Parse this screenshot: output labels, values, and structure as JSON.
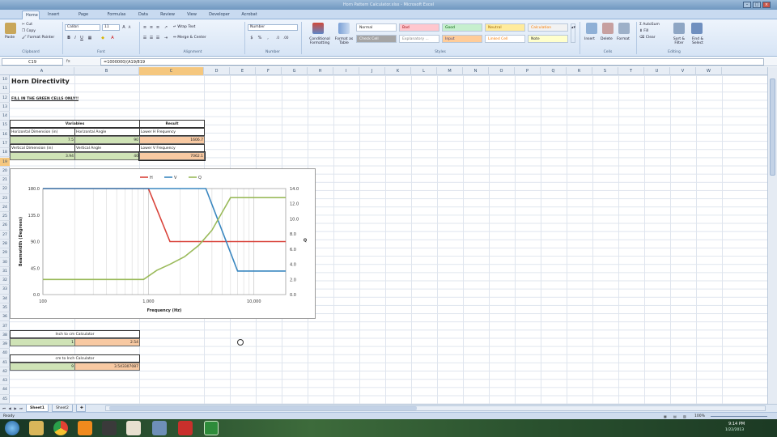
{
  "window": {
    "title": "Horn Pattern Calculator.xlsx - Microsoft Excel"
  },
  "ribbon_tabs": [
    "Home",
    "Insert",
    "Page Layout",
    "Formulas",
    "Data",
    "Review",
    "View",
    "Developer",
    "Acrobat"
  ],
  "ribbon": {
    "clipboard": {
      "paste": "Paste",
      "cut": "Cut",
      "copy": "Copy",
      "format_painter": "Format Painter",
      "label": "Clipboard"
    },
    "font": {
      "name": "Calibri",
      "size": "11",
      "label": "Font"
    },
    "alignment": {
      "wrap": "Wrap Text",
      "merge": "Merge & Center",
      "label": "Alignment"
    },
    "number": {
      "format": "Number",
      "label": "Number"
    },
    "styles": {
      "cond": "Conditional Formatting",
      "table": "Format as Table",
      "cell_styles": [
        {
          "name": "Normal",
          "bg": "#ffffff",
          "fg": "#222222"
        },
        {
          "name": "Bad",
          "bg": "#ffc7ce",
          "fg": "#9c0006"
        },
        {
          "name": "Good",
          "bg": "#c6efce",
          "fg": "#006100"
        },
        {
          "name": "Neutral",
          "bg": "#ffeb9c",
          "fg": "#9c6500"
        },
        {
          "name": "Calculation",
          "bg": "#f2f2f2",
          "fg": "#fa7d00"
        },
        {
          "name": "Check Cell",
          "bg": "#a5a5a5",
          "fg": "#ffffff"
        },
        {
          "name": "Explanatory ...",
          "bg": "#ffffff",
          "fg": "#7f7f7f"
        },
        {
          "name": "Input",
          "bg": "#ffcc99",
          "fg": "#3f3f76"
        },
        {
          "name": "Linked Cell",
          "bg": "#ffffff",
          "fg": "#fa7d00"
        },
        {
          "name": "Note",
          "bg": "#ffffcc",
          "fg": "#222222"
        }
      ],
      "label": "Styles"
    },
    "cells": {
      "insert": "Insert",
      "delete": "Delete",
      "format": "Format",
      "label": "Cells"
    },
    "editing": {
      "autosum": "AutoSum",
      "fill": "Fill",
      "clear": "Clear",
      "sort": "Sort & Filter",
      "find": "Find & Select",
      "label": "Editing"
    }
  },
  "formula_bar": {
    "name_box": "C19",
    "fx": "fx",
    "formula": "=1000000/(A19/819"
  },
  "columns": [
    "A",
    "B",
    "C",
    "D",
    "E",
    "F",
    "G",
    "H",
    "I",
    "J",
    "K",
    "L",
    "M",
    "N",
    "O",
    "P",
    "Q",
    "R",
    "S",
    "T",
    "U",
    "V",
    "W"
  ],
  "rows": [
    "10",
    "11",
    "12",
    "13",
    "14",
    "15",
    "16",
    "17",
    "18",
    "19",
    "20",
    "21",
    "22",
    "23",
    "24",
    "25",
    "26",
    "27",
    "28",
    "29",
    "30",
    "31",
    "32",
    "33",
    "34",
    "35",
    "36",
    "37",
    "38",
    "39",
    "40",
    "41",
    "42",
    "43",
    "44",
    "45"
  ],
  "sheet": {
    "title": "Horn Directivity",
    "instruction": "FILL IN THE GREEN CELLS ONLY!!",
    "variables_header": "Variables",
    "result_header": "Result",
    "h_dim_label": "Horizontal Dimension (in)",
    "h_angle_label": "Horizontal Angle",
    "lower_h_label": "Lower H Frequency",
    "h_dim": "7.5",
    "h_angle": "90",
    "lower_h": "1606.7",
    "v_dim_label": "Vertical Dimension (in)",
    "v_angle_label": "Vertical Angle",
    "lower_v_label": "Lower V Frequency",
    "v_dim": "3.94",
    "v_angle": "40",
    "lower_v": "7062.1",
    "inch_to_cm_label": "Inch to cm Calculator",
    "inch_value": "1",
    "cm_value": "2.54",
    "cm_to_inch_label": "cm to Inch Calculator",
    "cm_input": "9",
    "inch_result": "3.543307087"
  },
  "chart_data": {
    "type": "line",
    "x_scale": "log",
    "xlabel": "Frequency (Hz)",
    "ylabel": "Beamwidth (Degrees)",
    "y2label": "Q",
    "ylim": [
      0,
      180
    ],
    "y2lim": [
      0,
      14
    ],
    "xlim": [
      100,
      20000
    ],
    "y_ticks": [
      "0.0",
      "45.0",
      "90.0",
      "135.0",
      "180.0"
    ],
    "y2_ticks": [
      "0.0",
      "2.0",
      "4.0",
      "6.0",
      "8.0",
      "10.0",
      "12.0",
      "14.0"
    ],
    "x_ticks": [
      "100",
      "1,000",
      "10,000"
    ],
    "x_tick_values": [
      100,
      1000,
      10000
    ],
    "legend_position": "top",
    "series": [
      {
        "name": "H",
        "color": "#d9433a",
        "axis": "left",
        "x": [
          100,
          1000,
          1600,
          20000
        ],
        "y": [
          180,
          180,
          90,
          90
        ]
      },
      {
        "name": "V",
        "color": "#3a87c0",
        "axis": "left",
        "x": [
          100,
          3500,
          7000,
          20000
        ],
        "y": [
          180,
          180,
          40,
          40
        ]
      },
      {
        "name": "Q",
        "color": "#9aba5a",
        "axis": "right",
        "x": [
          100,
          900,
          1200,
          1600,
          2200,
          3000,
          4000,
          6000,
          20000
        ],
        "y": [
          2.0,
          2.0,
          3.2,
          4.0,
          5.0,
          6.5,
          8.5,
          12.8,
          12.8
        ]
      }
    ]
  },
  "sheet_tabs": [
    "Sheet1",
    "Sheet2"
  ],
  "status": {
    "mode": "Ready",
    "zoom": "100%"
  },
  "clock": {
    "time": "9:14 PM",
    "date": "1/22/2013"
  }
}
